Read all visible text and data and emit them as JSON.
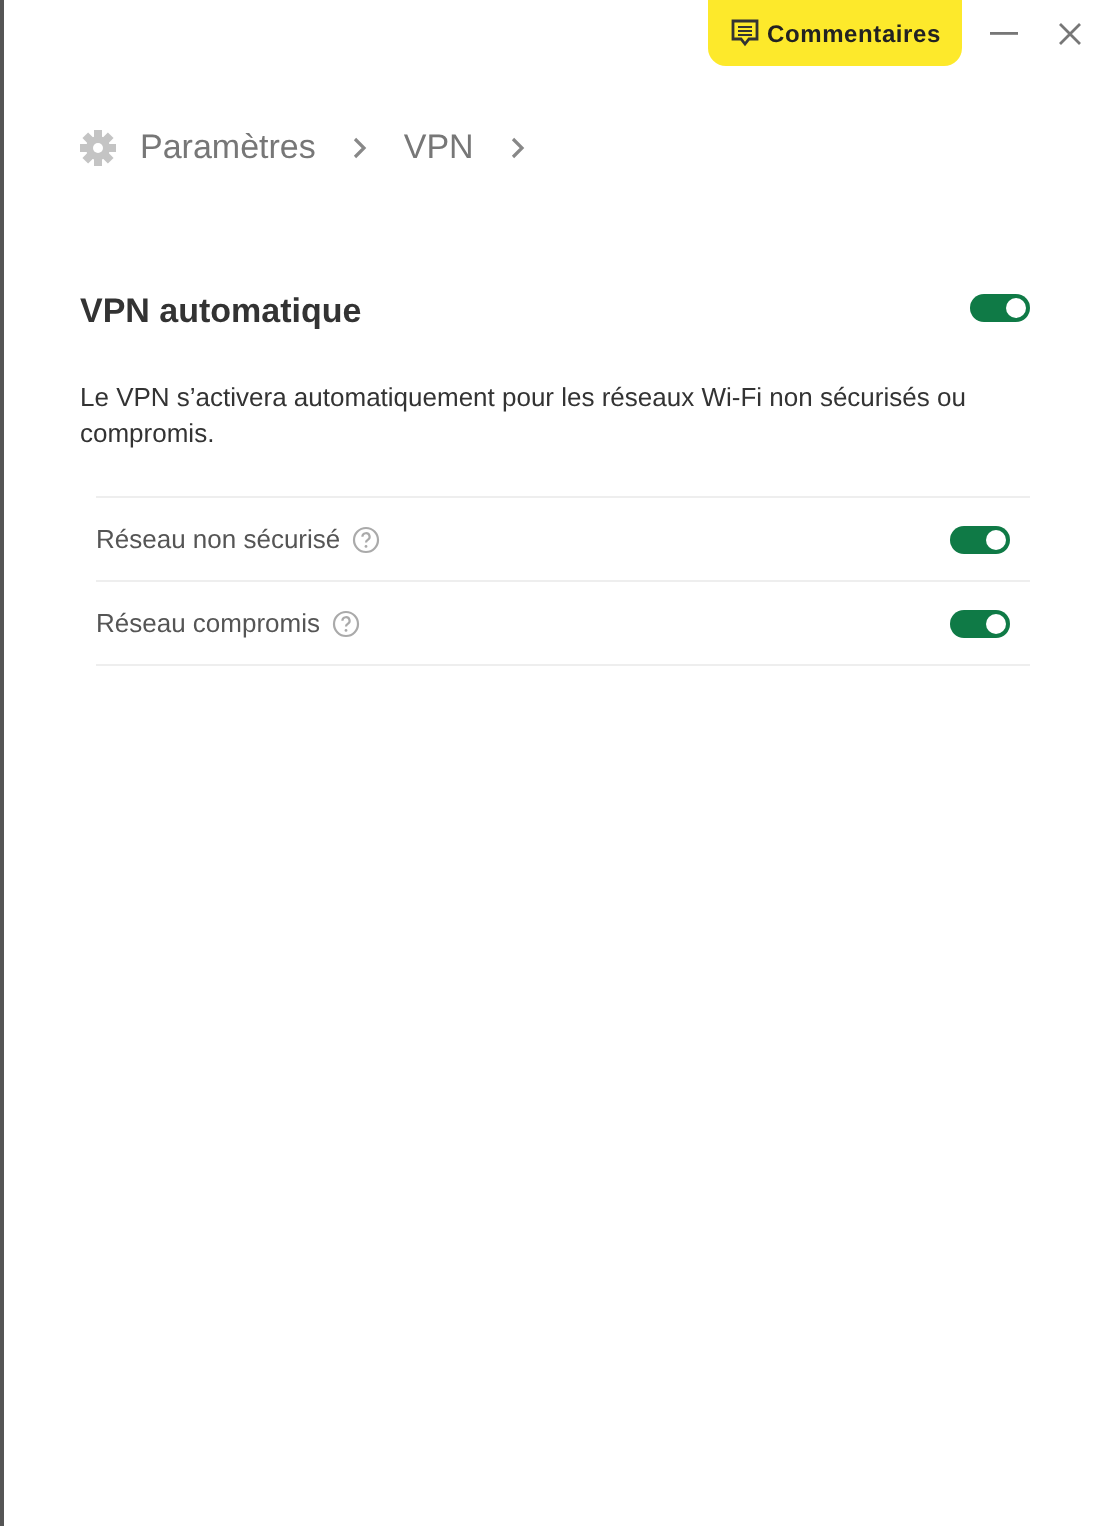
{
  "titlebar": {
    "feedback_button": "Commentaires"
  },
  "breadcrumb": [
    "Paramètres",
    "VPN"
  ],
  "section": {
    "title": "VPN automatique",
    "on": true,
    "description": "Le VPN s’activera automatiquement pour les réseaux Wi-Fi non sécurisés ou compromis."
  },
  "options": [
    {
      "label": "Réseau non sécurisé",
      "on": true
    },
    {
      "label": "Réseau compromis",
      "on": true
    }
  ]
}
